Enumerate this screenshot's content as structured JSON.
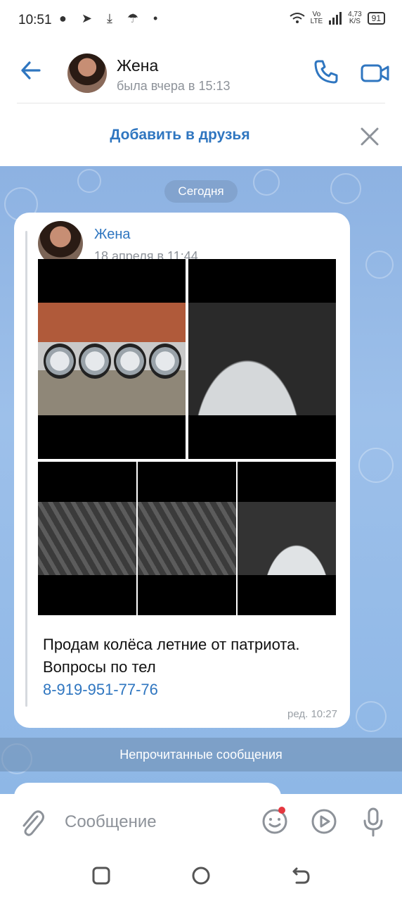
{
  "status_bar": {
    "time": "10:51",
    "notif_icons": "● ➤ ⤓ ☂ •",
    "net_top": "Vo",
    "net_bottom": "LTE",
    "speed_top": "4,73",
    "speed_bottom": "K/S",
    "battery": "91"
  },
  "header": {
    "contact_name": "Жена",
    "last_seen": "была вчера в 15:13"
  },
  "add_friend": {
    "label": "Добавить в друзья"
  },
  "chat": {
    "date_separator": "Сегодня",
    "message": {
      "forwarded_from": "Жена",
      "forwarded_date": "18 апреля в 11:44",
      "text": "Продам колёса летние от патриота. Вопросы по тел",
      "phone_link": "8-919-951-77-76",
      "edited": "ред. 10:27",
      "photo_count": 5
    },
    "unread_label": "Непрочитанные сообщения"
  },
  "composer": {
    "placeholder": "Сообщение"
  },
  "colors": {
    "accent": "#2f76c0",
    "chat_bg": "#9dc0ea",
    "badge_red": "#e5373f"
  },
  "icons": [
    "back-arrow-icon",
    "phone-icon",
    "video-camera-icon",
    "close-icon",
    "paperclip-icon",
    "emoji-icon",
    "play-circle-icon",
    "microphone-icon",
    "recent-apps-icon",
    "home-icon",
    "back-nav-icon"
  ]
}
